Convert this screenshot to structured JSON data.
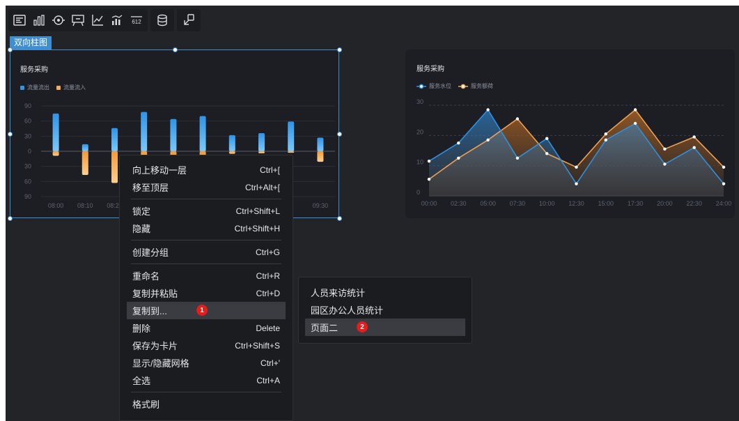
{
  "toolbar": {
    "icons": [
      "text-box-icon",
      "bar-chart-icon",
      "target-icon",
      "comment-icon",
      "axis-line-icon",
      "bar-line-icon",
      "number-icon",
      "database-icon",
      "link-shape-icon"
    ]
  },
  "selection_tag": "双向柱图",
  "colors": {
    "accent": "#3e8ed0",
    "blue_bar": "#2f93e6",
    "orange_bar": "#f7ac55",
    "badge": "#e31c1c"
  },
  "chart_left": {
    "title": "服务采购",
    "legend": [
      "流量流出",
      "流量流入"
    ],
    "chart_data": {
      "type": "bar",
      "title": "服务采购",
      "categories": [
        "08:00",
        "08:10",
        "08:20",
        "08:30",
        "08:40",
        "08:50",
        "09:00",
        "09:10",
        "09:20",
        "09:30"
      ],
      "x_tick_labels": [
        "08:00",
        "08:10",
        "08:20",
        "09:30"
      ],
      "y_tick_labels": [
        "90",
        "60",
        "30",
        "0",
        "30",
        "60",
        "90"
      ],
      "ylim": [
        -90,
        90
      ],
      "series": [
        {
          "name": "流量流出",
          "values": [
            75,
            14,
            46,
            78,
            64,
            70,
            32,
            36,
            59,
            27
          ]
        },
        {
          "name": "流量流入",
          "values": [
            -9,
            -47,
            -63,
            -38,
            -50,
            -60,
            -5,
            -4,
            -3,
            -21
          ]
        }
      ]
    }
  },
  "chart_right": {
    "title": "服务采购",
    "legend": [
      "服务水位",
      "服务额荷"
    ],
    "chart_data": {
      "type": "area",
      "title": "服务采购",
      "x": [
        "00:00",
        "02:30",
        "05:00",
        "07:30",
        "10:00",
        "12:30",
        "15:00",
        "17:30",
        "20:00",
        "22:30",
        "24:00"
      ],
      "y_tick_labels": [
        "30",
        "20",
        "10",
        "0"
      ],
      "ylim": [
        0,
        30
      ],
      "grid": true,
      "series": [
        {
          "name": "服务水位",
          "values": [
            11.5,
            17.5,
            28.5,
            12.5,
            19,
            4,
            18.5,
            24,
            10.5,
            16,
            4
          ]
        },
        {
          "name": "服务额荷",
          "values": [
            5.5,
            12.5,
            18.5,
            25.5,
            14,
            9.5,
            20.5,
            28.5,
            15.5,
            19.5,
            9.5
          ]
        }
      ]
    }
  },
  "context_menu": {
    "items": [
      {
        "label": "向上移动一层",
        "shortcut": "Ctrl+["
      },
      {
        "label": "移至顶层",
        "shortcut": "Ctrl+Alt+["
      },
      {
        "label": "锁定",
        "shortcut": "Ctrl+Shift+L"
      },
      {
        "label": "隐藏",
        "shortcut": "Ctrl+Shift+H"
      },
      {
        "label": "创建分组",
        "shortcut": "Ctrl+G"
      },
      {
        "label": "重命名",
        "shortcut": "Ctrl+R"
      },
      {
        "label": "复制并粘贴",
        "shortcut": "Ctrl+D"
      },
      {
        "label": "复制到...",
        "shortcut": ""
      },
      {
        "label": "删除",
        "shortcut": "Delete"
      },
      {
        "label": "保存为卡片",
        "shortcut": "Ctrl+Shift+S"
      },
      {
        "label": "显示/隐藏网格",
        "shortcut": "Ctrl+'"
      },
      {
        "label": "全选",
        "shortcut": "Ctrl+A"
      },
      {
        "label": "格式刷",
        "shortcut": ""
      }
    ],
    "badge": "1"
  },
  "submenu": {
    "items": [
      "人员来访统计",
      "园区办公人员统计",
      "页面二"
    ],
    "badge": "2"
  }
}
